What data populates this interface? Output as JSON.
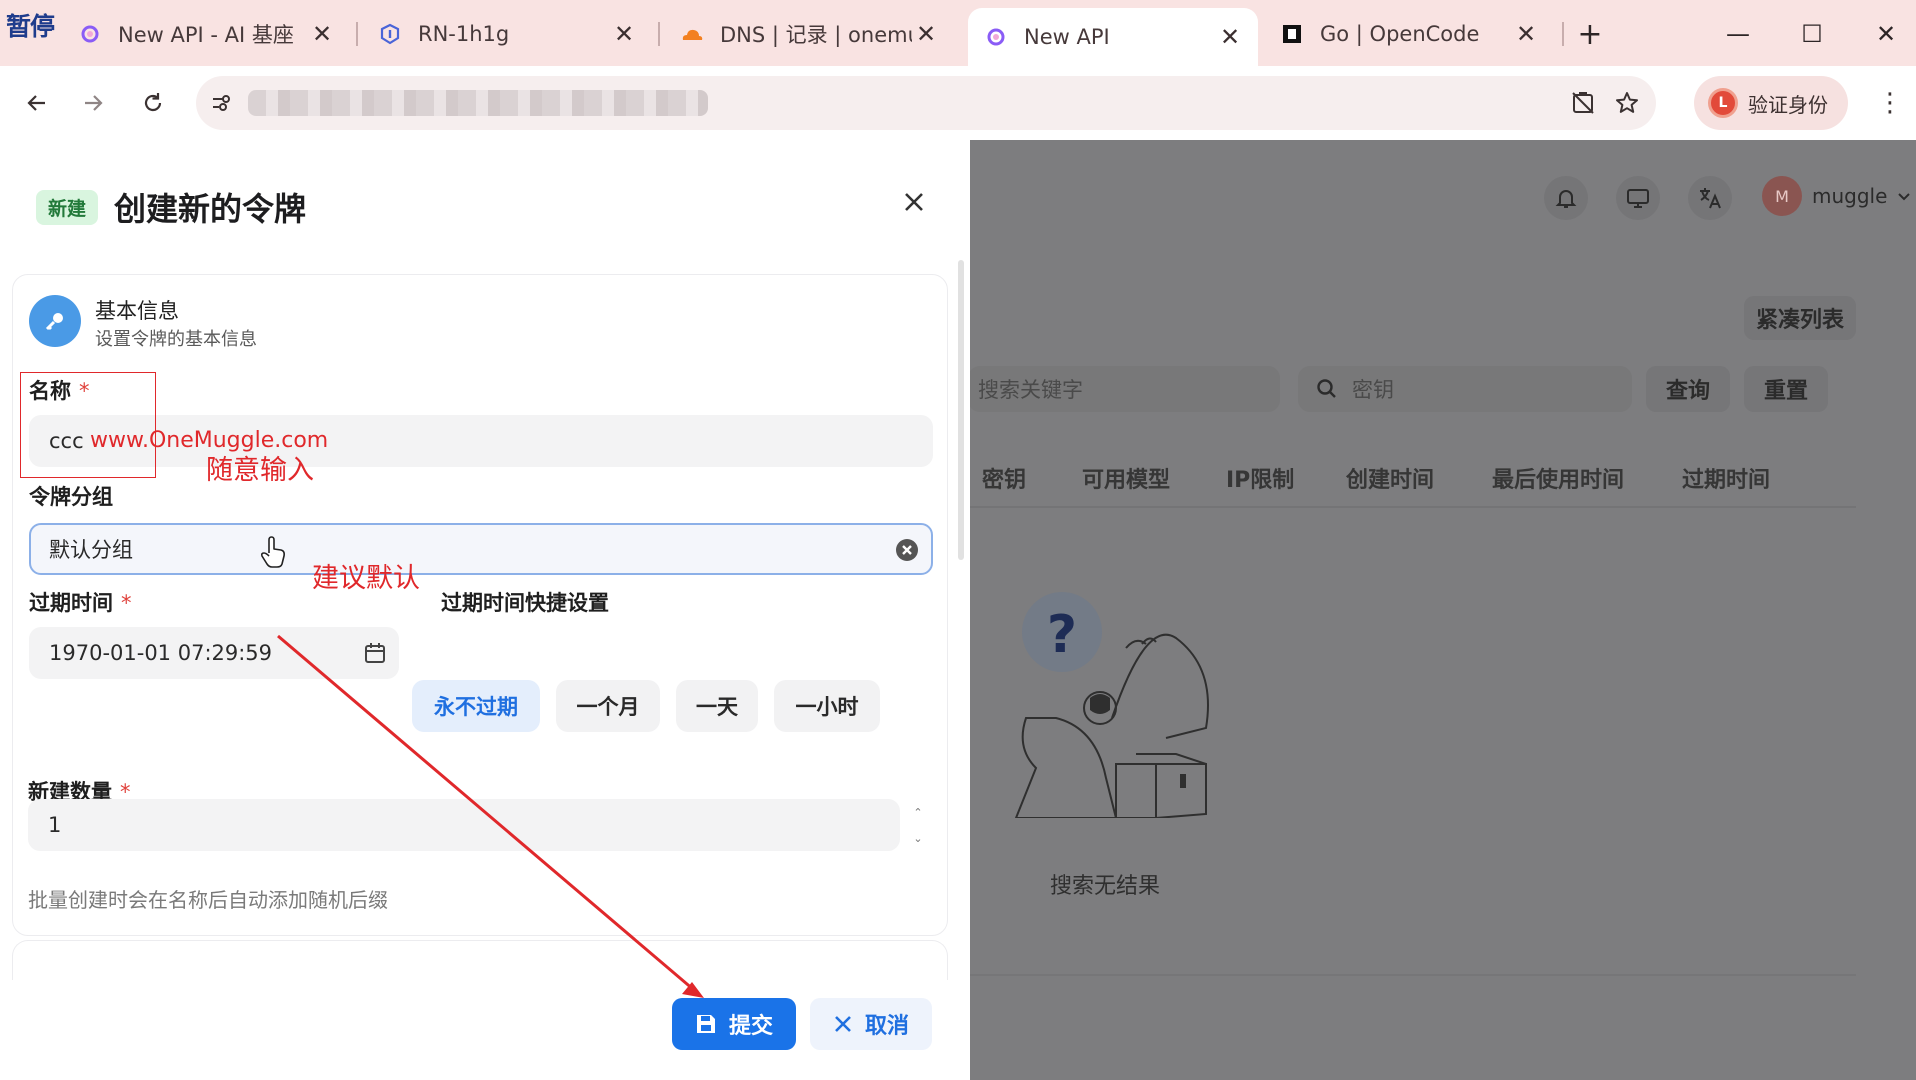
{
  "overlay": {
    "pause_label": "暂停"
  },
  "tabs": [
    {
      "title": "New API - AI 基座",
      "close": "✕"
    },
    {
      "title": "RN-1h1g",
      "close": "✕"
    },
    {
      "title": "DNS | 记录 | onemuggle",
      "close": "✕"
    },
    {
      "title": "New API",
      "close": "✕",
      "active": true
    },
    {
      "title": "Go | OpenCode",
      "close": "✕"
    }
  ],
  "tabstrip": {
    "new_tab": "+",
    "minimize": "—",
    "maximize": "☐",
    "close": "✕"
  },
  "toolbar": {
    "verify_label": "验证身份",
    "verify_avatar": "L",
    "menu": "⋮"
  },
  "background_app": {
    "user_name": "muggle",
    "user_avatar_letter": "M",
    "compact_list": "紧凑列表",
    "search_keyword_placeholder": "搜索关键字",
    "search_key_placeholder": "密钥",
    "query_button": "查询",
    "reset_button": "重置",
    "columns": [
      "密钥",
      "可用模型",
      "IP限制",
      "创建时间",
      "最后使用时间",
      "过期时间"
    ],
    "empty_text": "搜索无结果"
  },
  "sheet": {
    "badge": "新建",
    "title": "创建新的令牌",
    "section_title": "基本信息",
    "section_subtitle": "设置令牌的基本信息",
    "name_label": "名称",
    "name_value": "ccc",
    "group_label": "令牌分组",
    "group_value": "默认分组",
    "expire_label": "过期时间",
    "expire_value": "1970-01-01 07:29:59",
    "quick_label": "过期时间快捷设置",
    "quick_options": [
      "永不过期",
      "一个月",
      "一天",
      "一小时"
    ],
    "count_label": "新建数量",
    "count_value": "1",
    "hint": "批量创建时会在名称后自动添加随机后缀",
    "required_mark": "*",
    "submit": "提交",
    "cancel": "取消"
  },
  "annotations": {
    "watermark": "www.OneMuggle.com",
    "name_note": "随意输入",
    "group_note": "建议默认"
  }
}
